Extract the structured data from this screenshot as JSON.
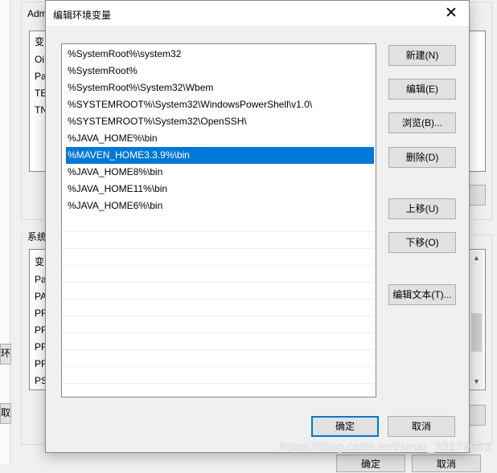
{
  "background": {
    "top_caption": "Adm",
    "top_list_rows": [
      "变",
      "Oi",
      "Pa",
      "TE",
      "TN"
    ],
    "bottom_caption": "系统",
    "bottom_list_rows": [
      "变",
      "Pa",
      "PA",
      "PF",
      "PF",
      "PF",
      "PF",
      "PS"
    ],
    "left_btn_1": "环",
    "left_btn_2": "取消",
    "bottom_btn_1": "确定",
    "bottom_btn_2": "取消"
  },
  "dialog": {
    "title": "编辑环境变量",
    "close_glyph": "✕"
  },
  "paths": [
    "%SystemRoot%\\system32",
    "%SystemRoot%",
    "%SystemRoot%\\System32\\Wbem",
    "%SYSTEMROOT%\\System32\\WindowsPowerShell\\v1.0\\",
    "%SYSTEMROOT%\\System32\\OpenSSH\\",
    "%JAVA_HOME%\\bin",
    "%MAVEN_HOME3.3.9%\\bin",
    "%JAVA_HOME8%\\bin",
    "%JAVA_HOME11%\\bin",
    "%JAVA_HOME6%\\bin"
  ],
  "selected_index": 6,
  "buttons": {
    "new": "新建(N)",
    "edit": "编辑(E)",
    "browse": "浏览(B)...",
    "delete": "删除(D)",
    "move_up": "上移(U)",
    "move_down": "下移(O)",
    "edit_text": "编辑文本(T)...",
    "ok": "确定",
    "cancel": "取消"
  },
  "colors": {
    "selection": "#0078d7",
    "default_button_border": "#0078d7"
  },
  "watermark": "https://blog.csdn.net/sinat_33179993"
}
